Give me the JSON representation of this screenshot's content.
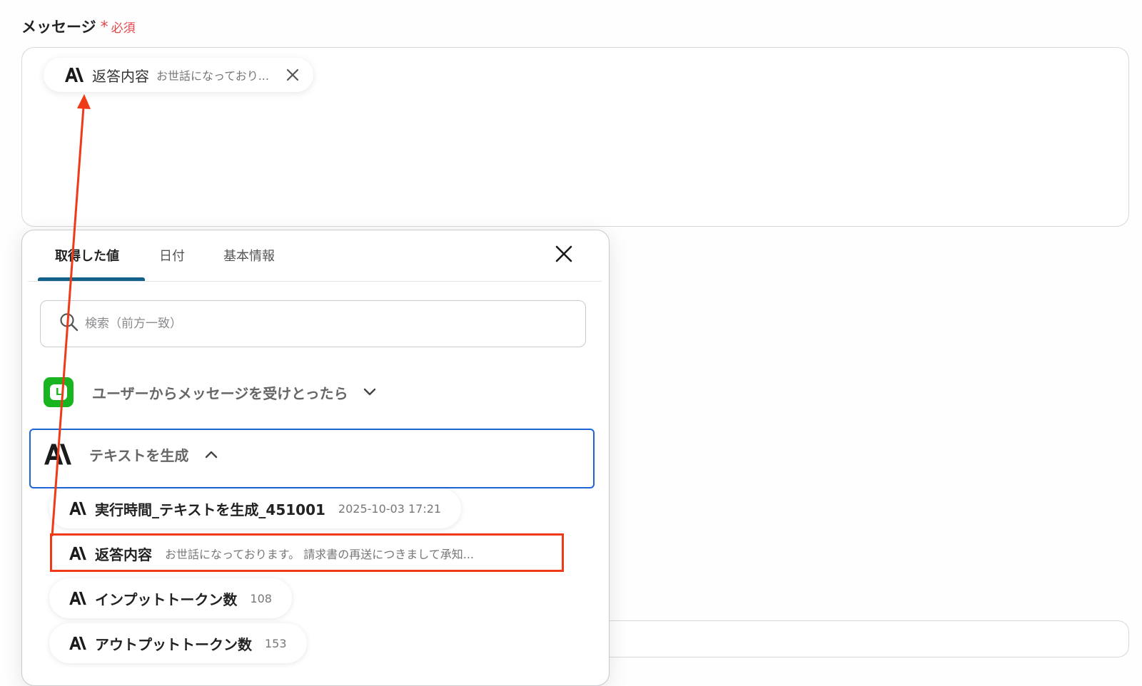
{
  "field": {
    "label": "メッセージ",
    "required_mark": "*",
    "required_text": "必須"
  },
  "message_chip": {
    "label": "返答内容",
    "value": "お世話になっており..."
  },
  "picker": {
    "tabs": [
      {
        "label": "取得した値",
        "active": true
      },
      {
        "label": "日付",
        "active": false
      },
      {
        "label": "基本情報",
        "active": false
      }
    ],
    "search_placeholder": "検索（前方一致）",
    "groups": [
      {
        "title": "ユーザーからメッセージを受けとったら",
        "icon": "line-app-icon",
        "expanded": false
      },
      {
        "title": "テキストを生成",
        "icon": "anthropic-logo-icon",
        "expanded": true
      }
    ],
    "items": [
      {
        "label": "実行時間_テキストを生成_451001",
        "value": "2025-10-03 17:21"
      },
      {
        "label": "返答内容",
        "value": "お世話になっております。 請求書の再送につきまして承知..."
      },
      {
        "label": "インプットトークン数",
        "value": "108"
      },
      {
        "label": "アウトプットトークン数",
        "value": "153"
      }
    ]
  },
  "colors": {
    "accent_tab": "#12618a",
    "selected_border": "#1d64d8",
    "annotation": "#f03a17",
    "required": "#e5484d",
    "line_green": "#19b521"
  }
}
